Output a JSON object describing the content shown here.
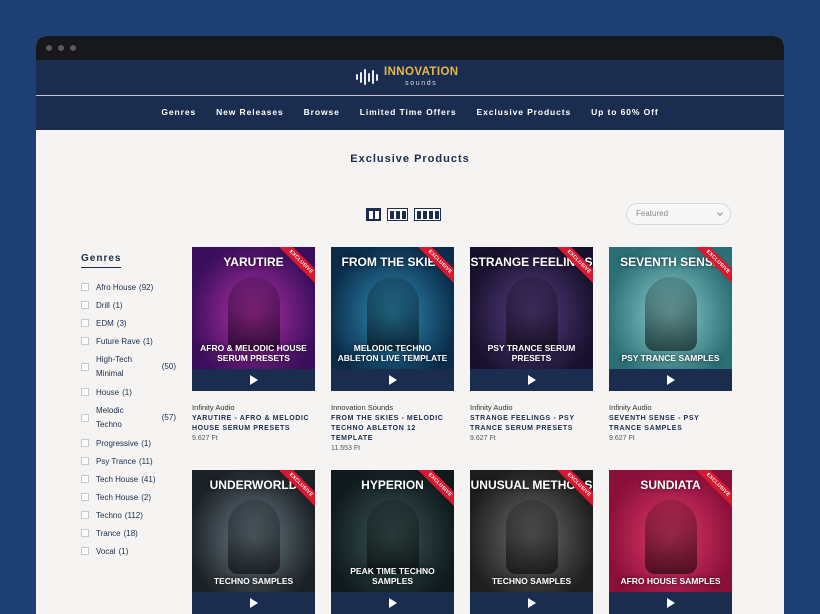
{
  "brand": {
    "name": "INNOVATION",
    "tagline": "sounds"
  },
  "nav": [
    "Genres",
    "New Releases",
    "Browse",
    "Limited Time Offers",
    "Exclusive Products",
    "Up to 60% Off"
  ],
  "page_title": "Exclusive Products",
  "sort": {
    "selected": "Featured"
  },
  "sidebar": {
    "title": "Genres",
    "genres": [
      {
        "name": "Afro House",
        "count": "(92)"
      },
      {
        "name": "Drill",
        "count": "(1)"
      },
      {
        "name": "EDM",
        "count": "(3)"
      },
      {
        "name": "Future Rave",
        "count": "(1)"
      },
      {
        "name": "High-Tech Minimal",
        "count": "(50)"
      },
      {
        "name": "House",
        "count": "(1)"
      },
      {
        "name": "Melodic Techno",
        "count": "(57)"
      },
      {
        "name": "Progressive",
        "count": "(1)"
      },
      {
        "name": "Psy Trance",
        "count": "(11)"
      },
      {
        "name": "Tech House",
        "count": "(41)"
      },
      {
        "name": "Tech House",
        "count": "(2)"
      },
      {
        "name": "Techno",
        "count": "(112)"
      },
      {
        "name": "Trance",
        "count": "(18)"
      },
      {
        "name": "Vocal",
        "count": "(1)"
      }
    ]
  },
  "ribbon_text": "EXCLUSIVE",
  "products": [
    {
      "art_title": "YARUTIRE",
      "art_sub": "AFRO & MELODIC HOUSE SERUM PRESETS",
      "vendor": "Infinity Audio",
      "name": "YARUTIRE - AFRO & MELODIC HOUSE SERUM PRESETS",
      "price": "9.627 Ft",
      "colors": [
        "#3b0f5c",
        "#b22fa7"
      ]
    },
    {
      "art_title": "FROM THE SKIES",
      "art_sub": "MELODIC TECHNO ABLETON LIVE TEMPLATE",
      "vendor": "Innovation Sounds",
      "name": "FROM THE SKIES - MELODIC TECHNO ABLETON 12 TEMPLATE",
      "price": "11.553 Ft",
      "colors": [
        "#0b2c4a",
        "#2f8fb8"
      ]
    },
    {
      "art_title": "STRANGE FEELINGS",
      "art_sub": "PSY TRANCE SERUM PRESETS",
      "vendor": "Infinity Audio",
      "name": "STRANGE FEELINGS - PSY TRANCE SERUM PRESETS",
      "price": "9.627 Ft",
      "colors": [
        "#17112d",
        "#5a3e85"
      ]
    },
    {
      "art_title": "SEVENTH SENSE",
      "art_sub": "PSY TRANCE SAMPLES",
      "vendor": "Infinity Audio",
      "name": "SEVENTH SENSE - PSY TRANCE SAMPLES",
      "price": "9.627 Ft",
      "colors": [
        "#2a6f76",
        "#8fd0cf"
      ]
    },
    {
      "art_title": "UNDERWORLD",
      "art_sub": "TECHNO SAMPLES",
      "vendor": "",
      "name": "",
      "price": "",
      "colors": [
        "#1c2126",
        "#6b7c86"
      ]
    },
    {
      "art_title": "HYPERION",
      "art_sub": "PEAK TIME TECHNO SAMPLES",
      "vendor": "",
      "name": "",
      "price": "",
      "colors": [
        "#0f1a1d",
        "#3d5757"
      ]
    },
    {
      "art_title": "UNUSUAL METHODS",
      "art_sub": "TECHNO SAMPLES",
      "vendor": "",
      "name": "",
      "price": "",
      "colors": [
        "#1e1e1e",
        "#6d6d6d"
      ]
    },
    {
      "art_title": "SUNDIATA",
      "art_sub": "AFRO HOUSE SAMPLES",
      "vendor": "",
      "name": "",
      "price": "",
      "colors": [
        "#8a0f3a",
        "#e23a6a"
      ]
    }
  ]
}
